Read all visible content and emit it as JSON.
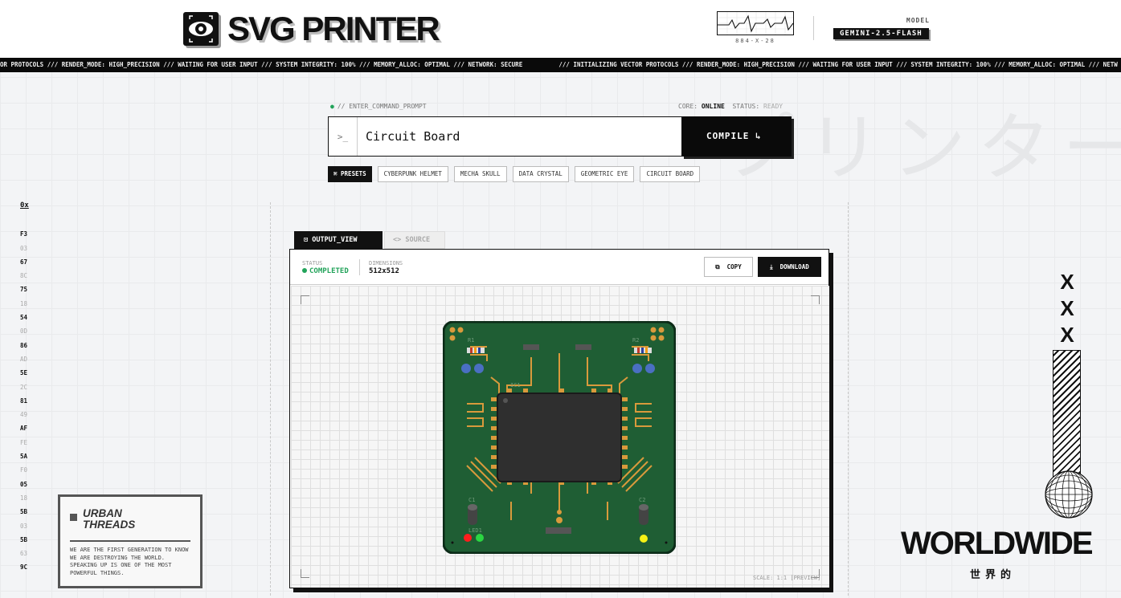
{
  "header": {
    "title": "SVG PRINTER",
    "logo_icon": "eye-icon",
    "waveform_code": "884-X-28",
    "model_label": "MODEL",
    "model_value": "GEMINI-2.5-FLASH"
  },
  "ticker": {
    "lead": "OR PROTOCOLS /// RENDER_MODE: HIGH_PRECISION /// WAITING FOR USER INPUT /// SYSTEM INTEGRITY: 100% /// MEMORY_ALLOC: OPTIMAL /// NETWORK: SECURE",
    "text": "/// INITIALIZING VECTOR PROTOCOLS /// RENDER_MODE: HIGH_PRECISION /// WAITING FOR USER INPUT /// SYSTEM INTEGRITY: 100% /// MEMORY_ALLOC: OPTIMAL /// NETW"
  },
  "watermark_jp": "プリンター",
  "command": {
    "label": "// ENTER_COMMAND_PROMPT",
    "core_label": "CORE:",
    "core_value": "ONLINE",
    "status_label": "STATUS:",
    "status_value": "READY",
    "prompt_icon": ">_",
    "input_value": "Circuit Board",
    "compile_label": "COMPILE ↳"
  },
  "presets": {
    "head_label": "⌘ PRESETS",
    "items": [
      "CYBERPUNK HELMET",
      "MECHA SKULL",
      "DATA CRYSTAL",
      "GEOMETRIC EYE",
      "CIRCUIT BOARD"
    ]
  },
  "hex_column": {
    "header": "0x",
    "items": [
      "F3",
      "03",
      "67",
      "8C",
      "75",
      "18",
      "54",
      "0D",
      "86",
      "AD",
      "5E",
      "2C",
      "81",
      "49",
      "AF",
      "FE",
      "5A",
      "F0",
      "05",
      "18",
      "5B",
      "03",
      "5B",
      "63",
      "9C"
    ]
  },
  "urban_threads": {
    "title_line1": "URBAN",
    "title_line2": "THREADS",
    "body": "WE ARE THE FIRST GENERATION TO KNOW WE ARE DESTROYING THE WORLD. SPEAKING UP IS ONE OF THE MOST POWERFUL THINGS."
  },
  "output": {
    "tab_output": "OUTPUT_VIEW",
    "tab_source": "SOURCE",
    "status_label": "STATUS",
    "status_value": "COMPLETED",
    "dimensions_label": "DIMENSIONS",
    "dimensions_value": "512x512",
    "copy_label": "COPY",
    "download_label": "DOWNLOAD",
    "scale_text": "SCALE: 1:1 [PREVIEW]"
  },
  "pcb": {
    "labels": {
      "r1": "R1",
      "r2": "R2",
      "ic1": "IC1",
      "c1": "C1",
      "c2": "C2",
      "led1": "LED1"
    },
    "colors": {
      "board": "#1f5e34",
      "trace": "#d99a3c",
      "chip": "#2f2f2f",
      "led_red": "#ff1d1d",
      "led_green": "#2bd642",
      "led_yellow": "#f5f215",
      "cap_blue": "#4a6fc2"
    }
  },
  "right_decor": {
    "xxx": [
      "X",
      "X",
      "X"
    ],
    "worldwide": "WORLDWIDE",
    "worldwide_jp": "世界的"
  }
}
